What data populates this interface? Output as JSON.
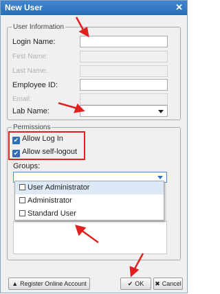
{
  "dialog": {
    "title": "New User",
    "close_glyph": "✕"
  },
  "user_info": {
    "legend": "User Information",
    "login_name_label": "Login Name:",
    "login_name_value": "",
    "first_name_label": "First Name:",
    "last_name_label": "Last Name:",
    "employee_id_label": "Employee ID:",
    "employee_id_value": "",
    "email_label": "Email:",
    "lab_name_label": "Lab Name:",
    "lab_name_value": ""
  },
  "permissions": {
    "legend": "Permissions",
    "allow_log_in_label": "Allow Log In",
    "allow_log_in_checked": true,
    "allow_self_logout_label": "Allow self-logout",
    "allow_self_logout_checked": true,
    "groups_label": "Groups:",
    "groups_value": "",
    "group_options": [
      {
        "label": "User Administrator",
        "checked": false
      },
      {
        "label": "Administrator",
        "checked": false
      },
      {
        "label": "Standard User",
        "checked": false
      }
    ]
  },
  "footer": {
    "register_label": "Register Online Account",
    "ok_label": "OK",
    "cancel_label": "Cancel"
  },
  "icons": {
    "user_icon": "person-icon",
    "check_icon": "checkmark-icon",
    "cancel_icon": "x-icon"
  },
  "colors": {
    "title_bar": "#2f76bf",
    "annotation_red": "#e02020",
    "highlight": "#dde9f7"
  }
}
